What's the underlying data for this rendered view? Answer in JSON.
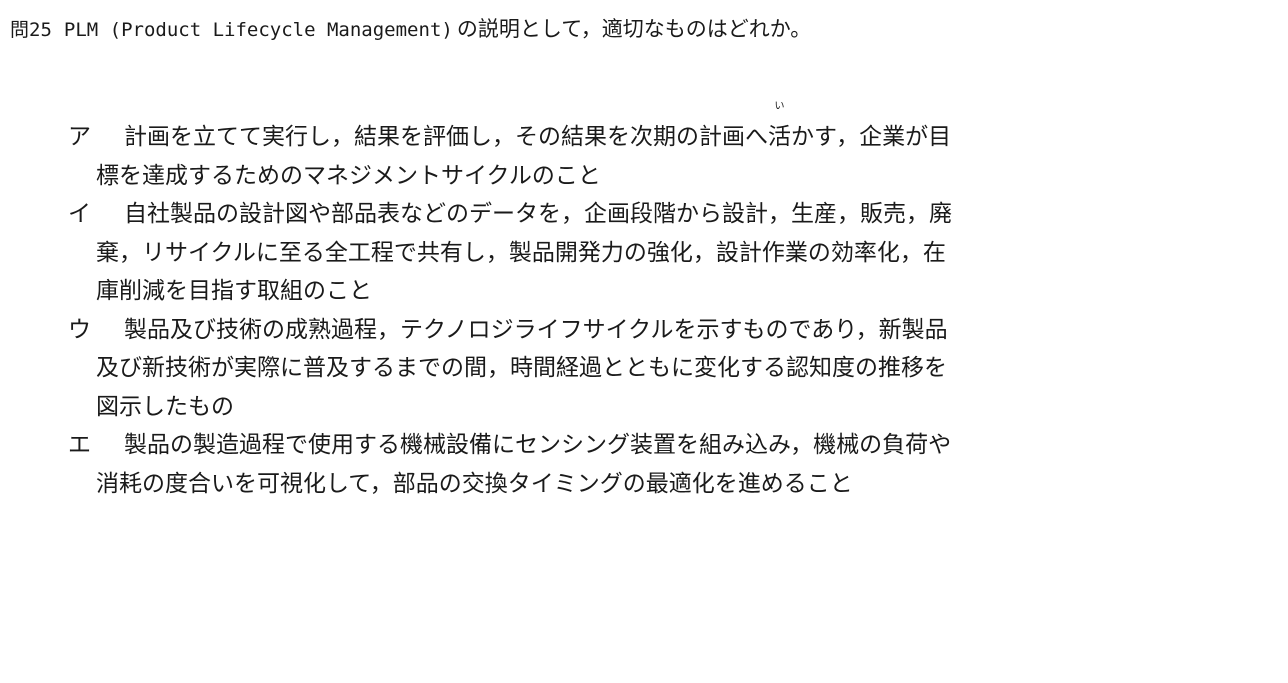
{
  "question": {
    "number": "問25",
    "english": "PLM (Product Lifecycle Management)",
    "japanese": "の説明として，適切なものはどれか。"
  },
  "options": [
    {
      "label": "ア",
      "line1_before": "計画を立てて実行し，結果を評価し，その結果を次期の計画へ",
      "ruby_base": "活",
      "ruby_text": "い",
      "line1_after": "かす，企業が目",
      "line2": "標を達成するためのマネジメントサイクルのこと"
    },
    {
      "label": "イ",
      "lines": [
        "自社製品の設計図や部品表などのデータを，企画段階から設計，生産，販売，廃",
        "棄，リサイクルに至る全工程で共有し，製品開発力の強化，設計作業の効率化，在",
        "庫削減を目指す取組のこと"
      ]
    },
    {
      "label": "ウ",
      "lines": [
        "製品及び技術の成熟過程，テクノロジライフサイクルを示すものであり，新製品",
        "及び新技術が実際に普及するまでの間，時間経過とともに変化する認知度の推移を",
        "図示したもの"
      ]
    },
    {
      "label": "エ",
      "lines": [
        "製品の製造過程で使用する機械設備にセンシング装置を組み込み，機械の負荷や",
        "消耗の度合いを可視化して，部品の交換タイミングの最適化を進めること"
      ]
    }
  ]
}
